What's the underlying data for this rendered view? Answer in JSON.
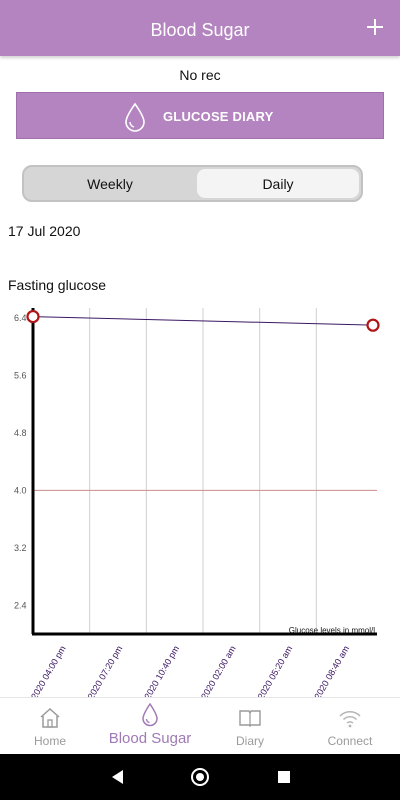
{
  "header": {
    "title": "Blood Sugar",
    "add_icon": "plus-icon"
  },
  "status": {
    "text": "No rec"
  },
  "diary_button": {
    "label": "GLUCOSE DIARY",
    "icon": "water-drop-icon"
  },
  "period_toggle": {
    "options": [
      "Weekly",
      "Daily"
    ],
    "selected": "Daily"
  },
  "date_label": "17 Jul 2020",
  "metric_label": "Fasting glucose",
  "chart_data": {
    "type": "line",
    "title": "",
    "ylabel": "",
    "xlabel": "",
    "ylim": [
      2.0,
      6.4
    ],
    "yticks": [
      "6.4",
      "5.6",
      "4.8",
      "4.0",
      "3.2",
      "2.4"
    ],
    "xticks": [
      "Jul 2020 04:00 pm",
      "Jul 2020 07:20 pm",
      "Jul 2020 10:40 pm",
      "Jul 2020 02:00 am",
      "Jul 2020 05:20 am",
      "Jul 2020 08:40 am"
    ],
    "reference_line": 4.0,
    "points": [
      {
        "x": "Jul 2020 04:00 pm",
        "y": 6.42
      },
      {
        "x": "Jul 2020 08:40 am",
        "y": 6.3
      }
    ],
    "annotation": "Glucose levels in mmol/l",
    "colors": {
      "line": "#3b1763",
      "marker": "#b01515",
      "reference": "#c78d8d",
      "grid": "#cfcfcf"
    }
  },
  "bottom_nav": {
    "items": [
      {
        "label": "Home",
        "icon": "home-icon",
        "active": false
      },
      {
        "label": "Blood Sugar",
        "icon": "water-drop-icon",
        "active": true
      },
      {
        "label": "Diary",
        "icon": "book-icon",
        "active": false
      },
      {
        "label": "Connect",
        "icon": "wifi-icon",
        "active": false
      }
    ]
  },
  "colors": {
    "accent": "#b384bf",
    "active_nav": "#a07ab5"
  }
}
